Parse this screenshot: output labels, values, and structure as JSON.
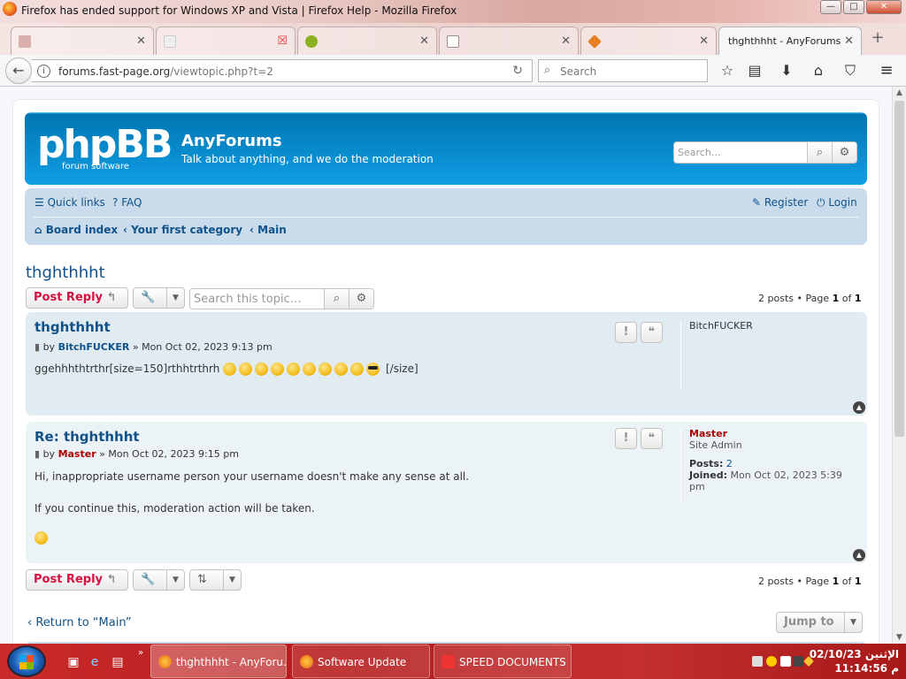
{
  "window": {
    "title": "Firefox has ended support for Windows XP and Vista | Firefox Help - Mozilla Firefox",
    "controls": {
      "minimize": "—",
      "maximize": "□",
      "close": "✕"
    }
  },
  "tabs": [
    {
      "label": "",
      "favicon_color": "#d9b0ad"
    },
    {
      "label": "",
      "favicon_color": "#e04040"
    },
    {
      "label": "",
      "favicon_color": "#8cb020"
    },
    {
      "label": "",
      "favicon_color": "#9a8f88"
    },
    {
      "label": "",
      "favicon_color": "#e67e22"
    },
    {
      "label": "thghthhht - AnyForums",
      "active": true
    }
  ],
  "nav": {
    "url_host": "forums.fast-page.org",
    "url_path": "/viewtopic.php?t=2",
    "search_placeholder": "Search",
    "icons": [
      "bookmark-star-icon",
      "reading-list-icon",
      "download-icon",
      "home-icon",
      "pocket-icon",
      "menu-icon"
    ]
  },
  "forum": {
    "logo_text": "phpBB",
    "logo_sub": "forum software",
    "site_name": "AnyForums",
    "site_desc": "Talk about anything, and we do the moderation",
    "search_placeholder": "Search…",
    "quick_links": "Quick links",
    "faq": "FAQ",
    "register": "Register",
    "login": "Login",
    "breadcrumbs": [
      "Board index",
      "Your first category",
      "Main"
    ],
    "topic_title": "thghthhht",
    "post_reply": "Post Reply",
    "topic_search_placeholder": "Search this topic…",
    "pagination": {
      "count": "2 posts • Page ",
      "current": "1",
      "of": " of ",
      "total": "1"
    },
    "posts": [
      {
        "title": "thghthhht",
        "by": "by ",
        "author": "BitchFUCKER",
        "date": " » Mon Oct 02, 2023 9:13 pm",
        "body_text": "ggehhhthtrthr[size=150]rthhtrthrh",
        "body_tail": " [/size]",
        "smilies": 10,
        "profile_name": "BitchFUCKER"
      },
      {
        "title": "Re: thghthhht",
        "by": "by ",
        "author": "Master",
        "date": " » Mon Oct 02, 2023 9:15 pm",
        "line1": "Hi, inappropriate username person your username doesn't make any sense at all.",
        "line2": "If you continue this, moderation action will be taken.",
        "profile_name": "Master",
        "rank": "Site Admin",
        "posts_label": "Posts:",
        "posts_value": "2",
        "joined_label": "Joined:",
        "joined_value": "Mon Oct 02, 2023 5:39 pm"
      }
    ],
    "return_link": "Return to “Main”",
    "jump_to": "Jump to"
  },
  "taskbar": {
    "tasks": [
      {
        "label": "thghthhht - AnyForu...",
        "active": true
      },
      {
        "label": "Software Update"
      },
      {
        "label": "SPEED DOCUMENTS"
      }
    ],
    "clock_date": "02/10/23 الإثنين",
    "clock_time": "11:14:56 م"
  }
}
